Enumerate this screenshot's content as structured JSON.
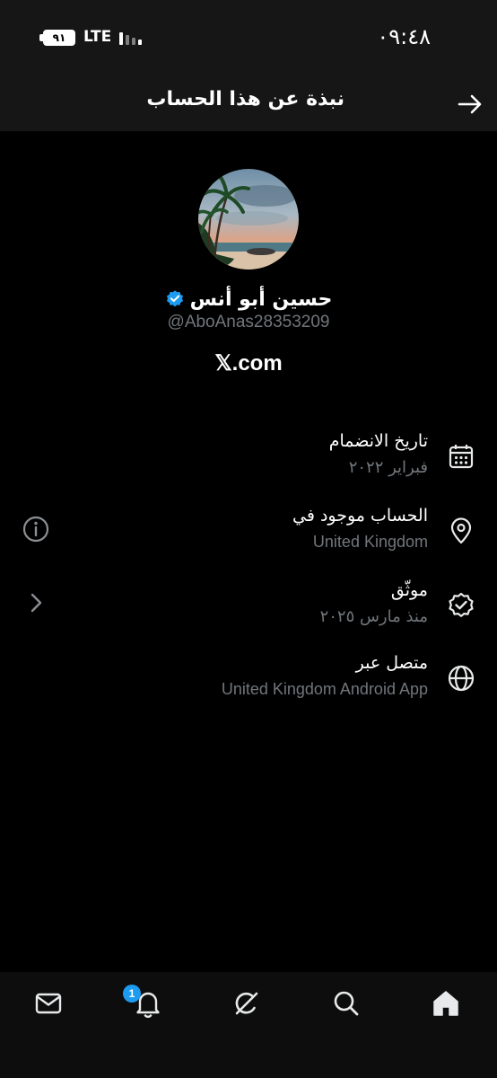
{
  "status_bar": {
    "battery": "٩١",
    "network": "LTE",
    "time": "٠٩:٤٨"
  },
  "header": {
    "title": "نبذة عن هذا الحساب"
  },
  "profile": {
    "display_name": "حسين أبو أنس",
    "handle": "@AboAnas28353209",
    "site": "𝕏.com",
    "verified_color": "#1d9bf0"
  },
  "info": {
    "joined": {
      "label": "تاريخ الانضمام",
      "value": "فبراير ٢٠٢٢",
      "icon": "calendar-icon"
    },
    "location": {
      "label": "الحساب موجود في",
      "value": "United Kingdom",
      "icon": "location-pin-icon"
    },
    "verified": {
      "label": "موثّق",
      "value": "منذ مارس ٢٠٢٥",
      "icon": "verified-check-icon"
    },
    "connected": {
      "label": "متصل عبر",
      "value": "United Kingdom Android App",
      "icon": "globe-icon"
    }
  },
  "bottom_nav": {
    "notifications_count": "1",
    "items": [
      "messages-icon",
      "notifications-bell-icon",
      "grok-icon",
      "search-icon",
      "home-icon"
    ]
  }
}
